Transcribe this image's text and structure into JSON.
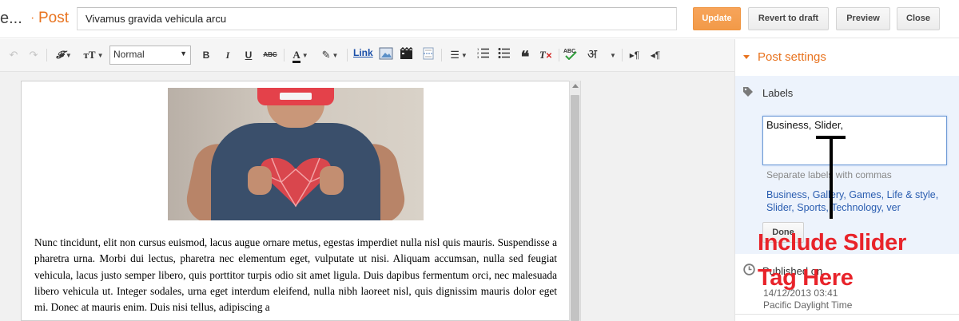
{
  "header": {
    "brand_dots": "e...",
    "breadcrumb_sep": "·",
    "breadcrumb": "Post",
    "post_title": "Vivamus gravida vehicula arcu",
    "buttons": {
      "update": "Update",
      "revert": "Revert to draft",
      "preview": "Preview",
      "close": "Close"
    }
  },
  "toolbar": {
    "font_style": "Normal",
    "link": "Link",
    "hindi_glyph": "अ",
    "ltr": "¶",
    "rtl": "¶",
    "icons": [
      "undo-icon",
      "redo-icon",
      "font-family-icon",
      "font-size-icon",
      "bold-icon",
      "italic-icon",
      "underline-icon",
      "strikethrough-icon",
      "text-color-icon",
      "highlight-icon",
      "image-icon",
      "video-icon",
      "jump-break-icon",
      "align-icon",
      "numbered-list-icon",
      "bulleted-list-icon",
      "quote-icon",
      "clear-format-icon",
      "spellcheck-icon",
      "transliterate-icon",
      "ltr-icon",
      "rtl-icon"
    ]
  },
  "editor": {
    "body": "Nunc tincidunt, elit non cursus euismod, lacus augue ornare metus, egestas imperdiet nulla nisl quis mauris. Suspendisse a pharetra urna. Morbi dui lectus, pharetra nec elementum eget, vulputate ut nisi. Aliquam accumsan, nulla sed feugiat vehicula, lacus justo semper libero, quis porttitor turpis odio sit amet ligula. Duis dapibus fermentum orci, nec malesuada libero vehicula ut. Integer sodales, urna eget interdum eleifend, nulla nibh laoreet nisl, quis dignissim mauris dolor eget mi. Donec at mauris enim. Duis nisi tellus, adipiscing a"
  },
  "sidebar": {
    "title": "Post settings",
    "labels": {
      "title": "Labels",
      "value": "Business, Slider,",
      "hint": "Separate labels with commas",
      "suggestions": [
        "Business",
        "Gallery",
        "Games",
        "Life & style",
        "Slider",
        "Sports",
        "Technology",
        "ver"
      ],
      "done": "Done"
    },
    "published": {
      "title": "Published on",
      "date": "14/12/2013 03:41",
      "timezone": "Pacific Daylight Time"
    }
  },
  "annotation": {
    "line1": "Include Slider",
    "line2": "Tag Here",
    "color": "#e8232a"
  },
  "colors": {
    "accent": "#e8731f",
    "update_button": "#f29a48",
    "link": "#2a5db0"
  }
}
